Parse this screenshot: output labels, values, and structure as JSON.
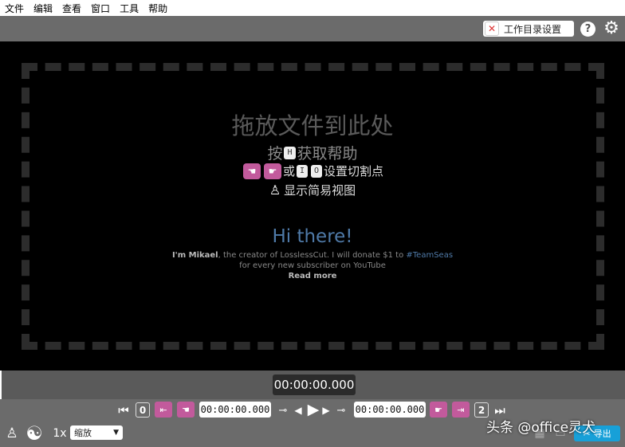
{
  "menu": [
    "文件",
    "编辑",
    "查看",
    "窗口",
    "工具",
    "帮助"
  ],
  "toolbar": {
    "workdir_label": "工作目录设置",
    "help_label": "?"
  },
  "dropzone": {
    "title": "拖放文件到此处",
    "hint_press": "按",
    "hint_key": "H",
    "hint_help": "获取帮助",
    "hint_or": "或",
    "key_in": "I",
    "key_out": "O",
    "hint_set_cut": "设置切割点",
    "hint_simple": "显示简易视图"
  },
  "promo": {
    "title": "Hi there!",
    "line1_name": "I'm Mikael",
    "line1_rest": ", the creator of LosslessCut. I will donate $1 to ",
    "line1_tag": "#TeamSeas",
    "line2": "for every new subscriber on YouTube",
    "read_more": "Read more"
  },
  "timeline": {
    "current_time": "00:00:00.000"
  },
  "controls": {
    "start_segment": "0",
    "cut_start_time": "00:00:00.000",
    "cut_end_time": "00:00:00.000",
    "end_segment": "2",
    "speed": "1x",
    "zoom_label": "缩放",
    "export_label": "导出"
  },
  "watermark": "头条 @office灵犬",
  "icons": {
    "accent_pink": "#c25a9c",
    "accent_blue": "#17a0d8"
  }
}
